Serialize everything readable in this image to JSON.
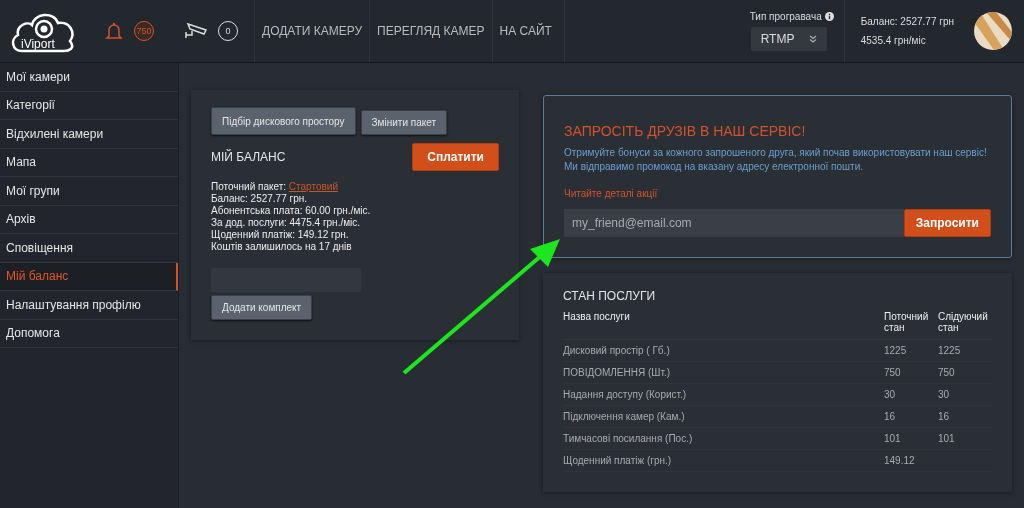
{
  "header": {
    "logo": "iViport",
    "alerts_count": "750",
    "cameras_count": "0",
    "nav": [
      "ДОДАТИ КАМЕРУ",
      "ПЕРЕГЛЯД КАМЕР",
      "НА САЙТ"
    ],
    "player": {
      "label": "Тип програвача",
      "value": "RTMP"
    },
    "balance": "Баланс: 2527.77 грн",
    "monthly": "4535.4 грн/міс"
  },
  "sidebar": {
    "items": [
      {
        "label": "Мої камери",
        "selected": false
      },
      {
        "label": "Категорії",
        "selected": false
      },
      {
        "label": "Відхилені камери",
        "selected": false
      },
      {
        "label": "Мапа",
        "selected": false
      },
      {
        "label": "Мої групи",
        "selected": false
      },
      {
        "label": "Архів",
        "selected": false
      },
      {
        "label": "Сповіщення",
        "selected": false
      },
      {
        "label": "Мій баланс",
        "selected": true
      },
      {
        "label": "Налаштування профілю",
        "selected": false
      },
      {
        "label": "Допомога",
        "selected": false
      }
    ]
  },
  "balance_card": {
    "buttons": [
      "Підбір дискового простору",
      "Змінити пакет"
    ],
    "title": "МІЙ БАЛАНС",
    "pay_button": "Сплатити",
    "package_label": "Поточний пакет:",
    "package_link": "Стартовий",
    "lines": [
      "Баланс: 2527.77 грн.",
      "Абонентська плата: 60.00 грн./міс.",
      "За дод. послуги: 4475.4 грн./міс.",
      "Щоденний платіж: 149.12 грн.",
      "Коштів залишилось на 17 днів"
    ],
    "add_button": "Додати комплект"
  },
  "invite": {
    "title": "ЗАПРОСІТЬ ДРУЗІВ В НАШ СЕРВІС!",
    "text": [
      "Отримуйте бонуси за кожного запрошеного друга, який почав використовувати наш сервіс!",
      "Ми відправимо промокод на вказану адресу електронної пошти."
    ],
    "details_link": "Читайте деталі акції",
    "email": {
      "placeholder": "my_friend@email.com"
    },
    "button": "Запросити"
  },
  "service": {
    "title": "СТАН ПОСЛУГИ",
    "columns": [
      "Назва послуги",
      "Поточний стан",
      "Слідуючий стан"
    ],
    "rows": [
      [
        "Дисковий простір ( Гб.)",
        "1225",
        "1225"
      ],
      [
        "ПОВІДОМЛЕННЯ (Шт.)",
        "750",
        "750"
      ],
      [
        "Надання доступу (Корист.)",
        "30",
        "30"
      ],
      [
        "Підключення камер (Кам.)",
        "16",
        "16"
      ],
      [
        "Тимчасові посилання (Пос.)",
        "101",
        "101"
      ],
      [
        "Щоденний платіж (грн.)",
        "149.12",
        ""
      ]
    ]
  }
}
